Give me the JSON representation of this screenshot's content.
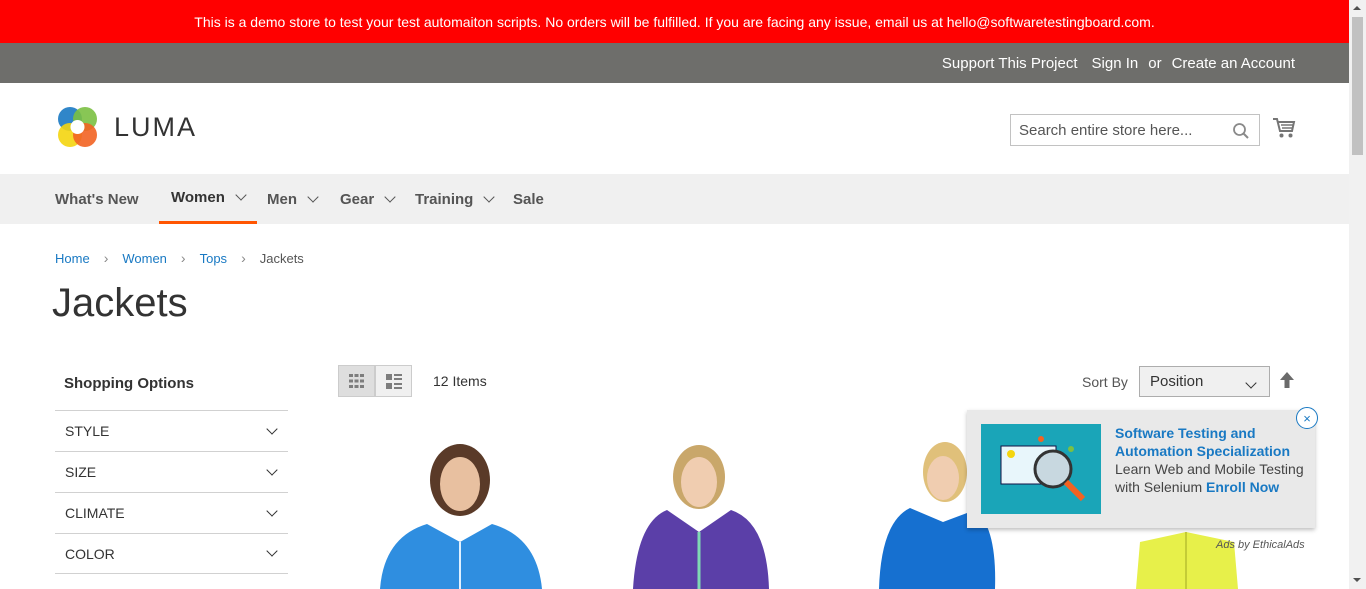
{
  "demo_notice": "This is a demo store to test your test automaiton scripts. No orders will be fulfilled. If you are facing any issue, email us at hello@softwaretestingboard.com.",
  "top_links": {
    "support": "Support This Project",
    "sign_in": "Sign In",
    "or": "or",
    "create_account": "Create an Account"
  },
  "logo_text": "LUMA",
  "search": {
    "placeholder": "Search entire store here..."
  },
  "nav": [
    {
      "label": "What's New",
      "has_menu": false
    },
    {
      "label": "Women",
      "has_menu": true,
      "active": true
    },
    {
      "label": "Men",
      "has_menu": true
    },
    {
      "label": "Gear",
      "has_menu": true
    },
    {
      "label": "Training",
      "has_menu": true
    },
    {
      "label": "Sale",
      "has_menu": false
    }
  ],
  "breadcrumb": [
    "Home",
    "Women",
    "Tops",
    "Jackets"
  ],
  "page_title": "Jackets",
  "sidebar": {
    "title": "Shopping Options",
    "filters": [
      "STYLE",
      "SIZE",
      "CLIMATE",
      "COLOR"
    ]
  },
  "toolbar": {
    "items_count": "12 Items",
    "sort_label": "Sort By",
    "sort_value": "Position"
  },
  "ad": {
    "headline": "Software Testing and Automation Specialization",
    "body": "Learn Web and Mobile Testing with Selenium ",
    "cta": "Enroll Now",
    "close": "×",
    "attribution": "Ads by EthicalAds"
  },
  "colors": {
    "demo_bar": "#ff0000",
    "top_bar": "#6e6e6b",
    "nav_active_underline": "#ff5501",
    "link": "#1979c3"
  }
}
